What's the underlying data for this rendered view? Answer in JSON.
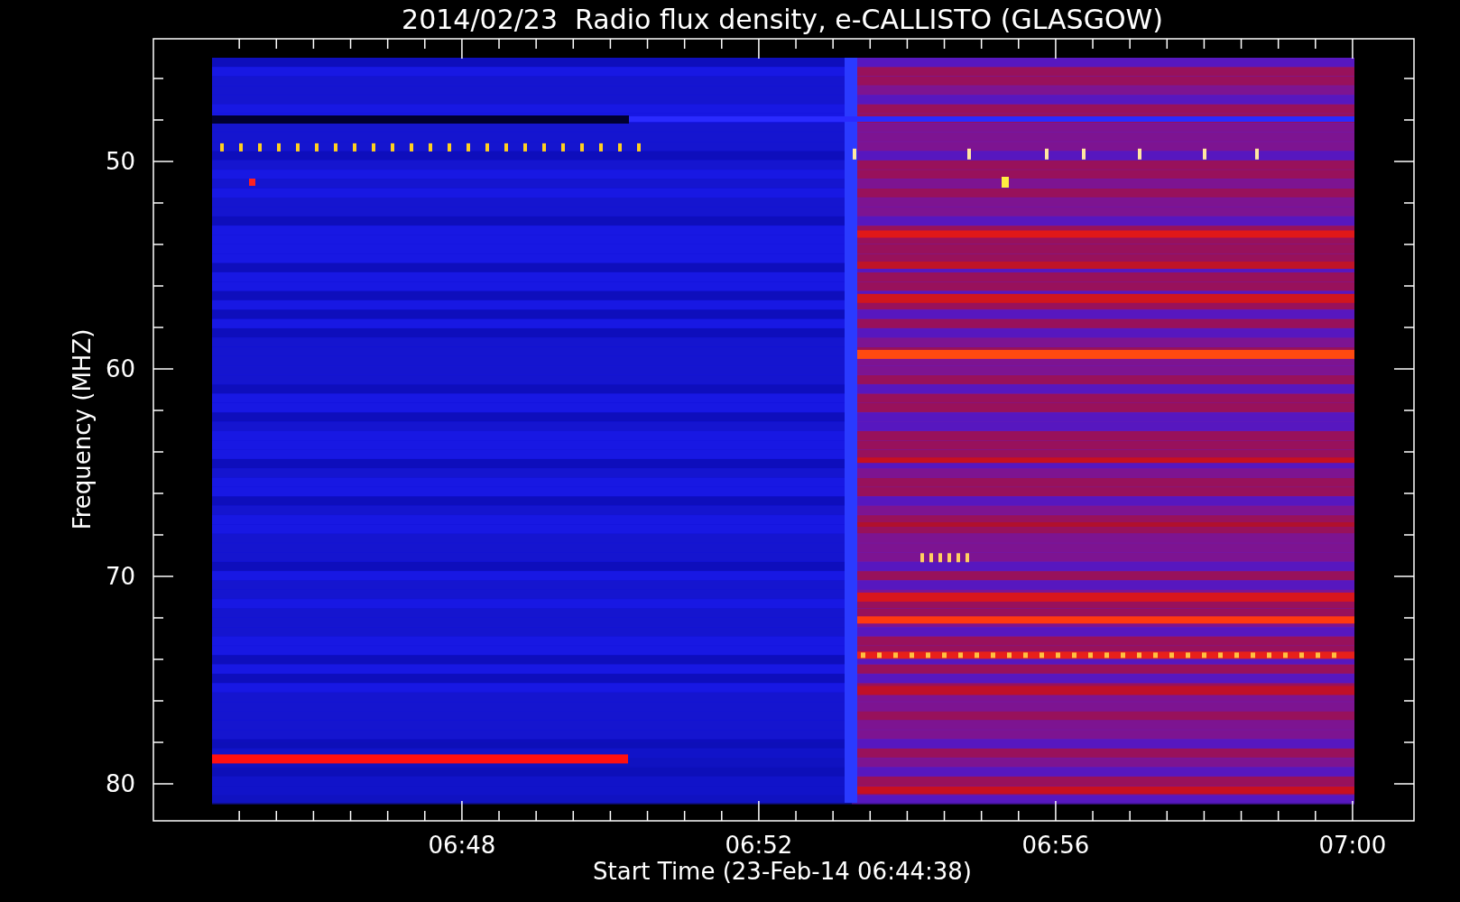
{
  "title": "2014/02/23  Radio flux density, e-CALLISTO (GLASGOW)",
  "y_axis": {
    "label": "Frequency (MHZ)",
    "ticks": [
      "50",
      "60",
      "70",
      "80"
    ]
  },
  "x_axis": {
    "label": "Start Time (23-Feb-14 06:44:38)",
    "ticks": [
      "06:48",
      "06:52",
      "06:56",
      "07:00"
    ]
  }
}
